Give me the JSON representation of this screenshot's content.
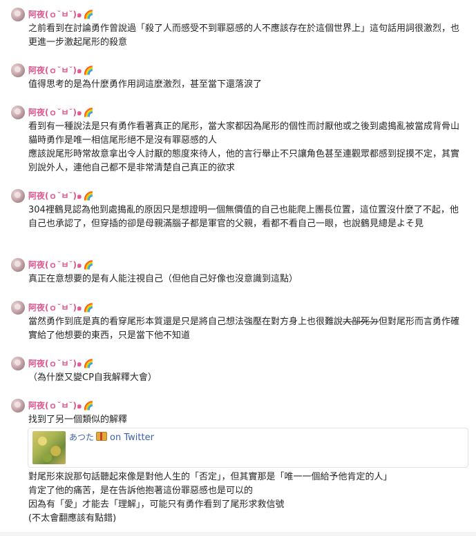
{
  "author": {
    "name": "阿夜(ｏ˘ㅂ˘)๑",
    "badge_emoji": "🌈"
  },
  "messages": [
    {
      "lines": [
        "之前看到在討論勇作曾說過「殺了人而感受不到罪惡感的人不應該存在於這個世界上」這句話用詞很激烈，也更進一步激起尾形的殺意"
      ]
    },
    {
      "lines": [
        "值得思考的是為什麼勇作用詞這麼激烈，甚至當下還落淚了"
      ]
    },
    {
      "lines": [
        "看到有一種說法是只有勇作看著真正的尾形，當大家都因為尾形的個性而討厭他或之後到處搗亂被當成背骨山貓時勇作是唯一相信尾形絕不是沒有罪惡感的人",
        "應該說尾形時常故意拿出令人討厭的態度來待人，他的言行舉止不只讓角色甚至連觀眾都感到捉摸不定，其實別說外人，連他自己都不是非常清楚自己真正的欲求"
      ]
    },
    {
      "lines": [
        "304裡鶴見認為他到處搗亂的原因只是想證明一個無價值的自己也能爬上團長位置，這位置沒什麼了不起，他自己也承認了，但穿插的卻是母親滿腦子都是軍官的父親，看都不看自己一眼，也說鶴見總是よそ見"
      ]
    },
    {
      "lines": [
        "真正在意想要的是有人能注視自己（但他自己好像也沒意識到這點）"
      ]
    },
    {
      "before": "當然勇作到底是真的看穿尾形本質還是只是將自己想法強壓在對方身上也很難說",
      "struck": "大部死ㄉ",
      "after": "但對尾形而言勇作確實給了他想要的東西，只是當下他不知道"
    },
    {
      "lines": [
        "（為什麼又變CP自我解釋大會）"
      ]
    },
    {
      "lines": [
        "找到了另一個類似的解釋"
      ],
      "embed": {
        "author": "あつた",
        "source": "on Twitter"
      },
      "after_lines": [
        "對尾形來說那句話聽起來像是對他人生的「否定」，但其實那是「唯一一個給予他肯定的人」",
        "肯定了他的痛苦，是在告訴他抱著這份罪惡感也是可以的",
        "因為有「愛」才能去「理解」，可能只有勇作看到了尾形求救信號",
        "(不太會翻應該有點錯)"
      ]
    }
  ],
  "colors": {
    "name": "#e0568f",
    "link": "#3b5ea8",
    "text": "#262626"
  }
}
